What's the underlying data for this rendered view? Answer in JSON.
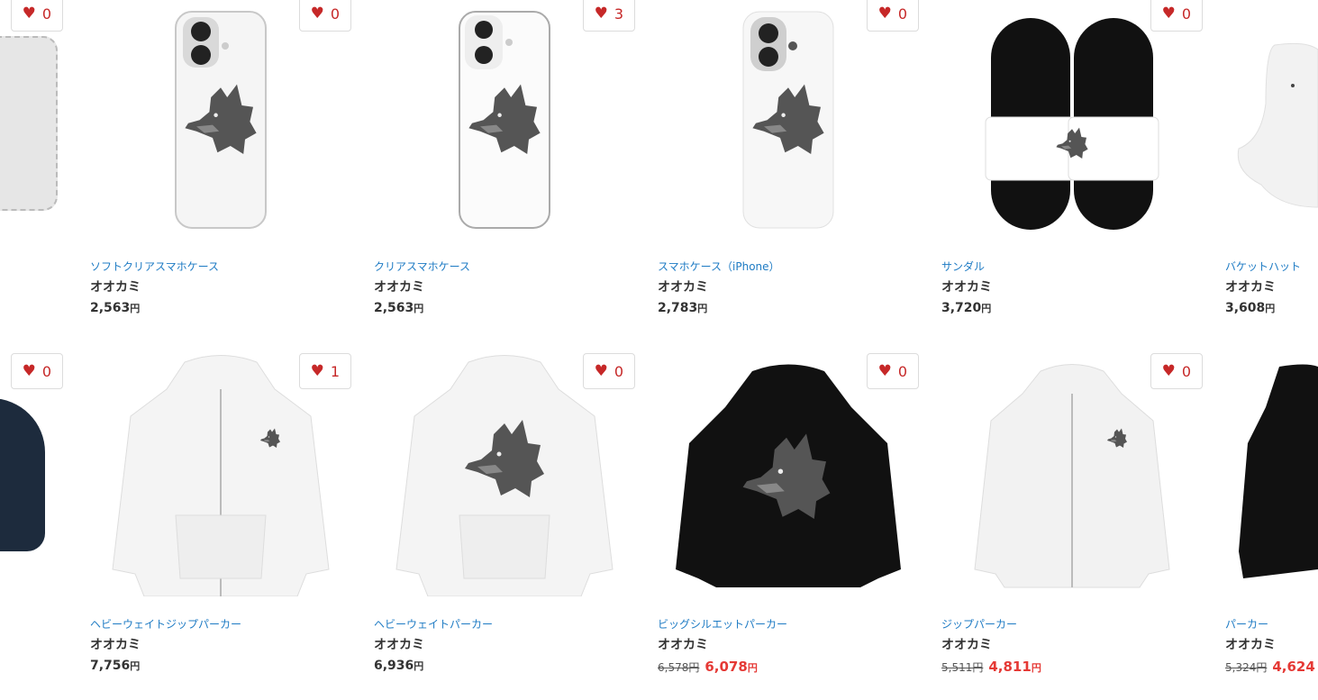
{
  "colors": {
    "accent_blue": "#1e7bc4",
    "heart_red": "#c62828",
    "sale_red": "#e53935",
    "text": "#333333"
  },
  "partial_left": [
    {
      "likes": "0"
    },
    {
      "likes": "0"
    }
  ],
  "products": [
    {
      "category": "ソフトクリアスマホケース",
      "title": "オオカミ",
      "price": "2,563",
      "yen": "円",
      "likes": "0"
    },
    {
      "category": "クリアスマホケース",
      "title": "オオカミ",
      "price": "2,563",
      "yen": "円",
      "likes": "3"
    },
    {
      "category": "スマホケース（iPhone）",
      "title": "オオカミ",
      "price": "2,783",
      "yen": "円",
      "likes": "0"
    },
    {
      "category": "サンダル",
      "title": "オオカミ",
      "price": "3,720",
      "yen": "円",
      "likes": "0"
    },
    {
      "category": "バケットハット",
      "title": "オオカミ",
      "price": "3,608",
      "yen": "円"
    },
    {
      "category": "ヘビーウェイトジップパーカー",
      "title": "オオカミ",
      "price": "7,756",
      "yen": "円",
      "likes": "1"
    },
    {
      "category": "ヘビーウェイトパーカー",
      "title": "オオカミ",
      "price": "6,936",
      "yen": "円",
      "likes": "0"
    },
    {
      "category": "ビッグシルエットパーカー",
      "title": "オオカミ",
      "old_price": "6,578円",
      "sale_price": "6,078",
      "yen": "円",
      "likes": "0"
    },
    {
      "category": "ジップパーカー",
      "title": "オオカミ",
      "old_price": "5,511円",
      "sale_price": "4,811",
      "yen": "円",
      "likes": "0"
    },
    {
      "category": "パーカー",
      "title": "オオカミ",
      "old_price": "5,324円",
      "sale_price": "4,624"
    }
  ]
}
